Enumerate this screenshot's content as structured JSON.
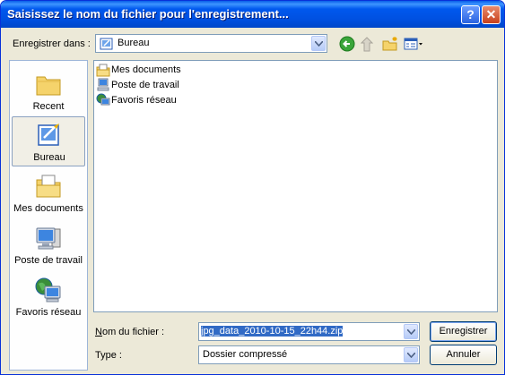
{
  "window": {
    "title": "Saisissez le nom du fichier pour l'enregistrement..."
  },
  "titlebar_buttons": {
    "help": "?",
    "close": "✕"
  },
  "save_in": {
    "label": "Enregistrer dans :",
    "value": "Bureau"
  },
  "toolbar": {
    "icons": [
      "back-icon",
      "up-folder-icon",
      "new-folder-icon",
      "view-menu-icon"
    ]
  },
  "places": [
    {
      "label": "Recent",
      "icon": "recent-folder-icon"
    },
    {
      "label": "Bureau",
      "icon": "desktop-icon",
      "selected": true
    },
    {
      "label": "Mes documents",
      "icon": "my-documents-icon"
    },
    {
      "label": "Poste de travail",
      "icon": "my-computer-icon"
    },
    {
      "label": "Favoris réseau",
      "icon": "network-places-icon"
    }
  ],
  "files": [
    {
      "label": "Mes documents",
      "icon": "my-documents-icon"
    },
    {
      "label": "Poste de travail",
      "icon": "my-computer-icon"
    },
    {
      "label": "Favoris réseau",
      "icon": "network-places-icon"
    }
  ],
  "filename": {
    "label": "Nom du fichier :",
    "value": "jpg_data_2010-10-15_22h44.zip"
  },
  "filetype": {
    "label": "Type :",
    "value": "Dossier compressé"
  },
  "buttons": {
    "save": "Enregistrer",
    "cancel": "Annuler"
  },
  "colors": {
    "title_bar": "#0054e3",
    "dialog_bg": "#ece9d8",
    "selection": "#316ac5"
  }
}
